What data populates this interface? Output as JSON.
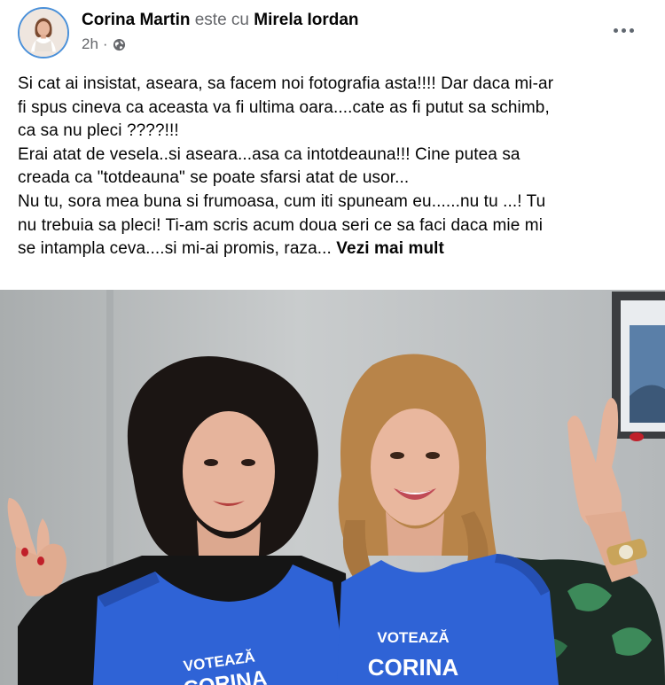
{
  "post": {
    "author": "Corina Martin",
    "connector": "este cu",
    "tagged": "Mirela Iordan",
    "time": "2h",
    "separator": "·",
    "privacy_icon": "globe-icon",
    "more_icon": "more-dots-icon"
  },
  "body": {
    "lines": [
      "Si cat ai insistat, aseara, sa facem noi fotografia asta!!!! Dar daca mi-ar",
      "fi spus cineva ca aceasta va fi ultima oara....cate as fi putut sa schimb,",
      "ca sa nu pleci ????!!!",
      "Erai atat de vesela..si aseara...asa ca intotdeauna!!! Cine putea sa",
      "creada ca \"totdeauna\" se poate sfarsi atat de usor...",
      "Nu tu, sora mea buna si frumoasa, cum iti spuneam eu......nu tu ...! Tu",
      "nu trebuia sa pleci! Ti-am scris acum doua seri ce sa faci daca mie mi",
      "se intampla ceva....si mi-ai promis, raza..."
    ],
    "see_more": "Vezi mai mult"
  },
  "photo": {
    "vest_left_top": "VOTEAZĂ",
    "vest_left_bottom": "CORINA",
    "vest_right_top": "VOTEAZĂ",
    "vest_right_bottom": "CORINA"
  },
  "colors": {
    "vest_blue": "#2f63d6",
    "text_primary": "#050505",
    "text_secondary": "#65676b",
    "avatar_border": "#4a90d9"
  }
}
